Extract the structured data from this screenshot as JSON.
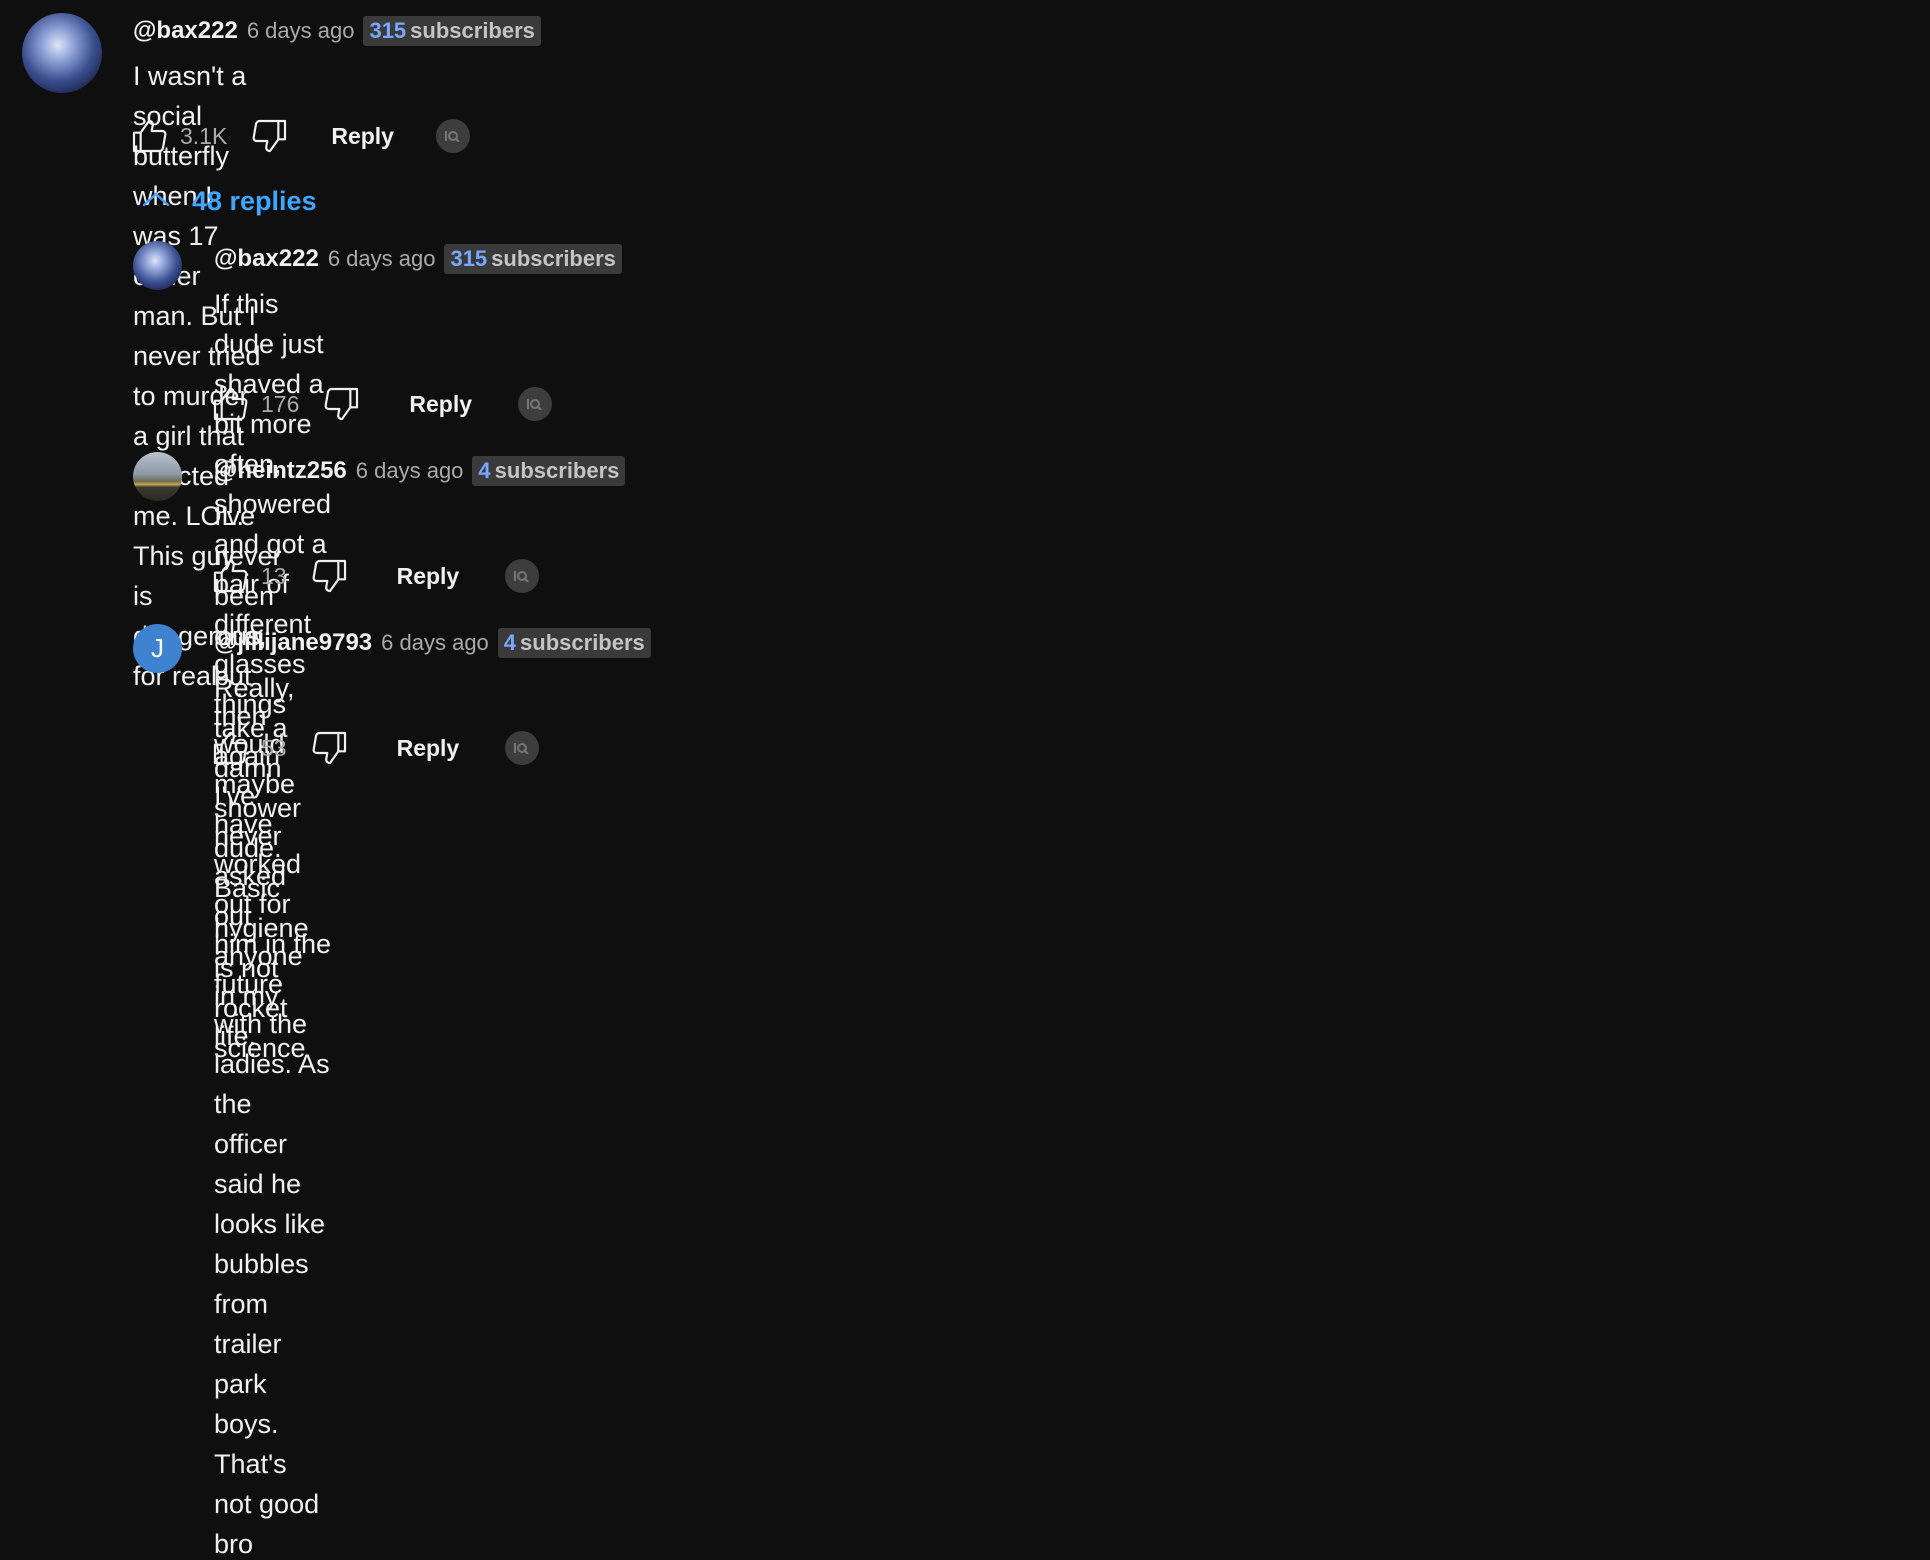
{
  "top_comment": {
    "handle": "@bax222",
    "time": "6 days ago",
    "badge_count": "315",
    "badge_label": "subscribers",
    "text": "I wasn't a social butterfly when I was 17 either man. But I never tried to murder a girl that rejected me. LOL. This guy is dangerous for real",
    "likes": "3.1K",
    "reply_label": "Reply"
  },
  "replies_toggle": {
    "label": "48 replies"
  },
  "replies": [
    {
      "handle": "@bax222",
      "time": "6 days ago",
      "badge_count": "315",
      "badge_label": "subscribers",
      "text_line1": "If this dude just shaved a bit more often, showered and got a pair of different glasses things would maybe have worked out for him in the",
      "text_line2": "future with the ladies. As the officer said he looks like bubbles from trailer park boys. That's not good bro",
      "likes": "176",
      "reply_label": "Reply"
    },
    {
      "handle": "@heintz256",
      "time": "6 days ago",
      "badge_count": "4",
      "badge_label": "subscribers",
      "text": "I've never been one, but then again I've never asked out anyone in my life.",
      "likes": "13",
      "reply_label": "Reply"
    },
    {
      "handle": "@jillijane9793",
      "time": "6 days ago",
      "badge_count": "4",
      "badge_label": "subscribers",
      "avatar_letter": "J",
      "text": "Really, take a damn shower dude. Basic hygiene is not rocket science",
      "likes": "53",
      "reply_label": "Reply"
    }
  ],
  "icons": {
    "like": "thumbs-up-icon",
    "dislike": "thumbs-down-icon",
    "owner": "channel-owner-badge-icon",
    "toggle": "chevron-up-icon"
  },
  "colors": {
    "background": "#0f0f0f",
    "accent": "#3ea6ff",
    "badge_number": "#7aa7ff",
    "avatar_letter_bg": "#3f82cf"
  }
}
